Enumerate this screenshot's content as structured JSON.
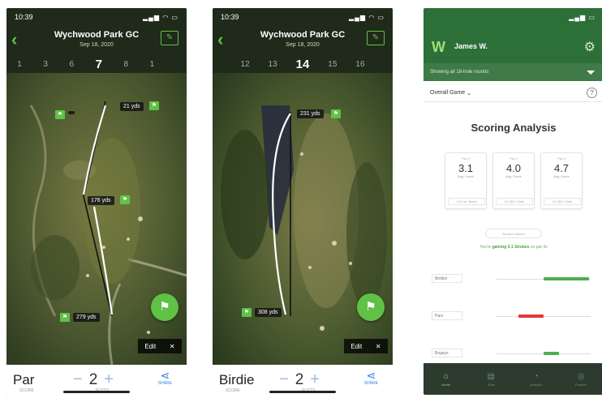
{
  "phones": [
    {
      "status_time": "10:39",
      "course": "Wychwood Park GC",
      "date": "Sep 18, 2020",
      "holes": [
        "1",
        "3",
        "6",
        "7",
        "8",
        "1",
        ""
      ],
      "current_hole": "7",
      "yardages": {
        "tee": "",
        "near_tee": "21 yds",
        "mid": "176 yds",
        "bottom": "279 yds"
      },
      "edit_chip": "Edit",
      "score_name": "Par",
      "score_sub": "SCORE",
      "putts": "2",
      "putts_sub": "PUTTS",
      "share_sub": "SHARE"
    },
    {
      "status_time": "10:39",
      "course": "Wychwood Park GC",
      "date": "Sep 18, 2020",
      "holes": [
        "",
        "12",
        "13",
        "14",
        "15",
        "16",
        ""
      ],
      "current_hole": "14",
      "yardages": {
        "top": "231 yds",
        "bottom": "308 yds"
      },
      "edit_chip": "Edit",
      "score_name": "Birdie",
      "score_sub": "SCORE",
      "putts": "2",
      "putts_sub": "PUTTS",
      "share_sub": "SHARE"
    }
  ],
  "analysis": {
    "user": "James W.",
    "filter_text": "Showing all 18-hole rounds",
    "game_filter": "Overall Game",
    "title": "Scoring Analysis",
    "cards": [
      {
        "label": "Par 3",
        "value": "3.1",
        "sub": "Avg. Score",
        "btm": "+0.1 vs. Score"
      },
      {
        "label": "Par 4",
        "value": "4.0",
        "sub": "Avg. Score",
        "btm": "0.0 SG / Hole"
      },
      {
        "label": "Par 5",
        "value": "4.7",
        "sub": "Avg. Score",
        "btm": "0.0 SG / Hole"
      }
    ],
    "pill": "Strokes Gained",
    "tip_pre": "You're ",
    "tip_bold": "gaining 0.1 Strokes",
    "tip_post": " on par 3s",
    "rows": [
      {
        "label": "Birdies",
        "color": "#4caf50",
        "value": 0.9
      },
      {
        "label": "Pars",
        "color": "#e53935",
        "value": -0.5
      },
      {
        "label": "Bogeys",
        "color": "#4caf50",
        "value": 0.3
      }
    ],
    "tabs": [
      "Home",
      "Stats",
      "Analysis",
      "Practice"
    ],
    "active_tab": "Home"
  }
}
